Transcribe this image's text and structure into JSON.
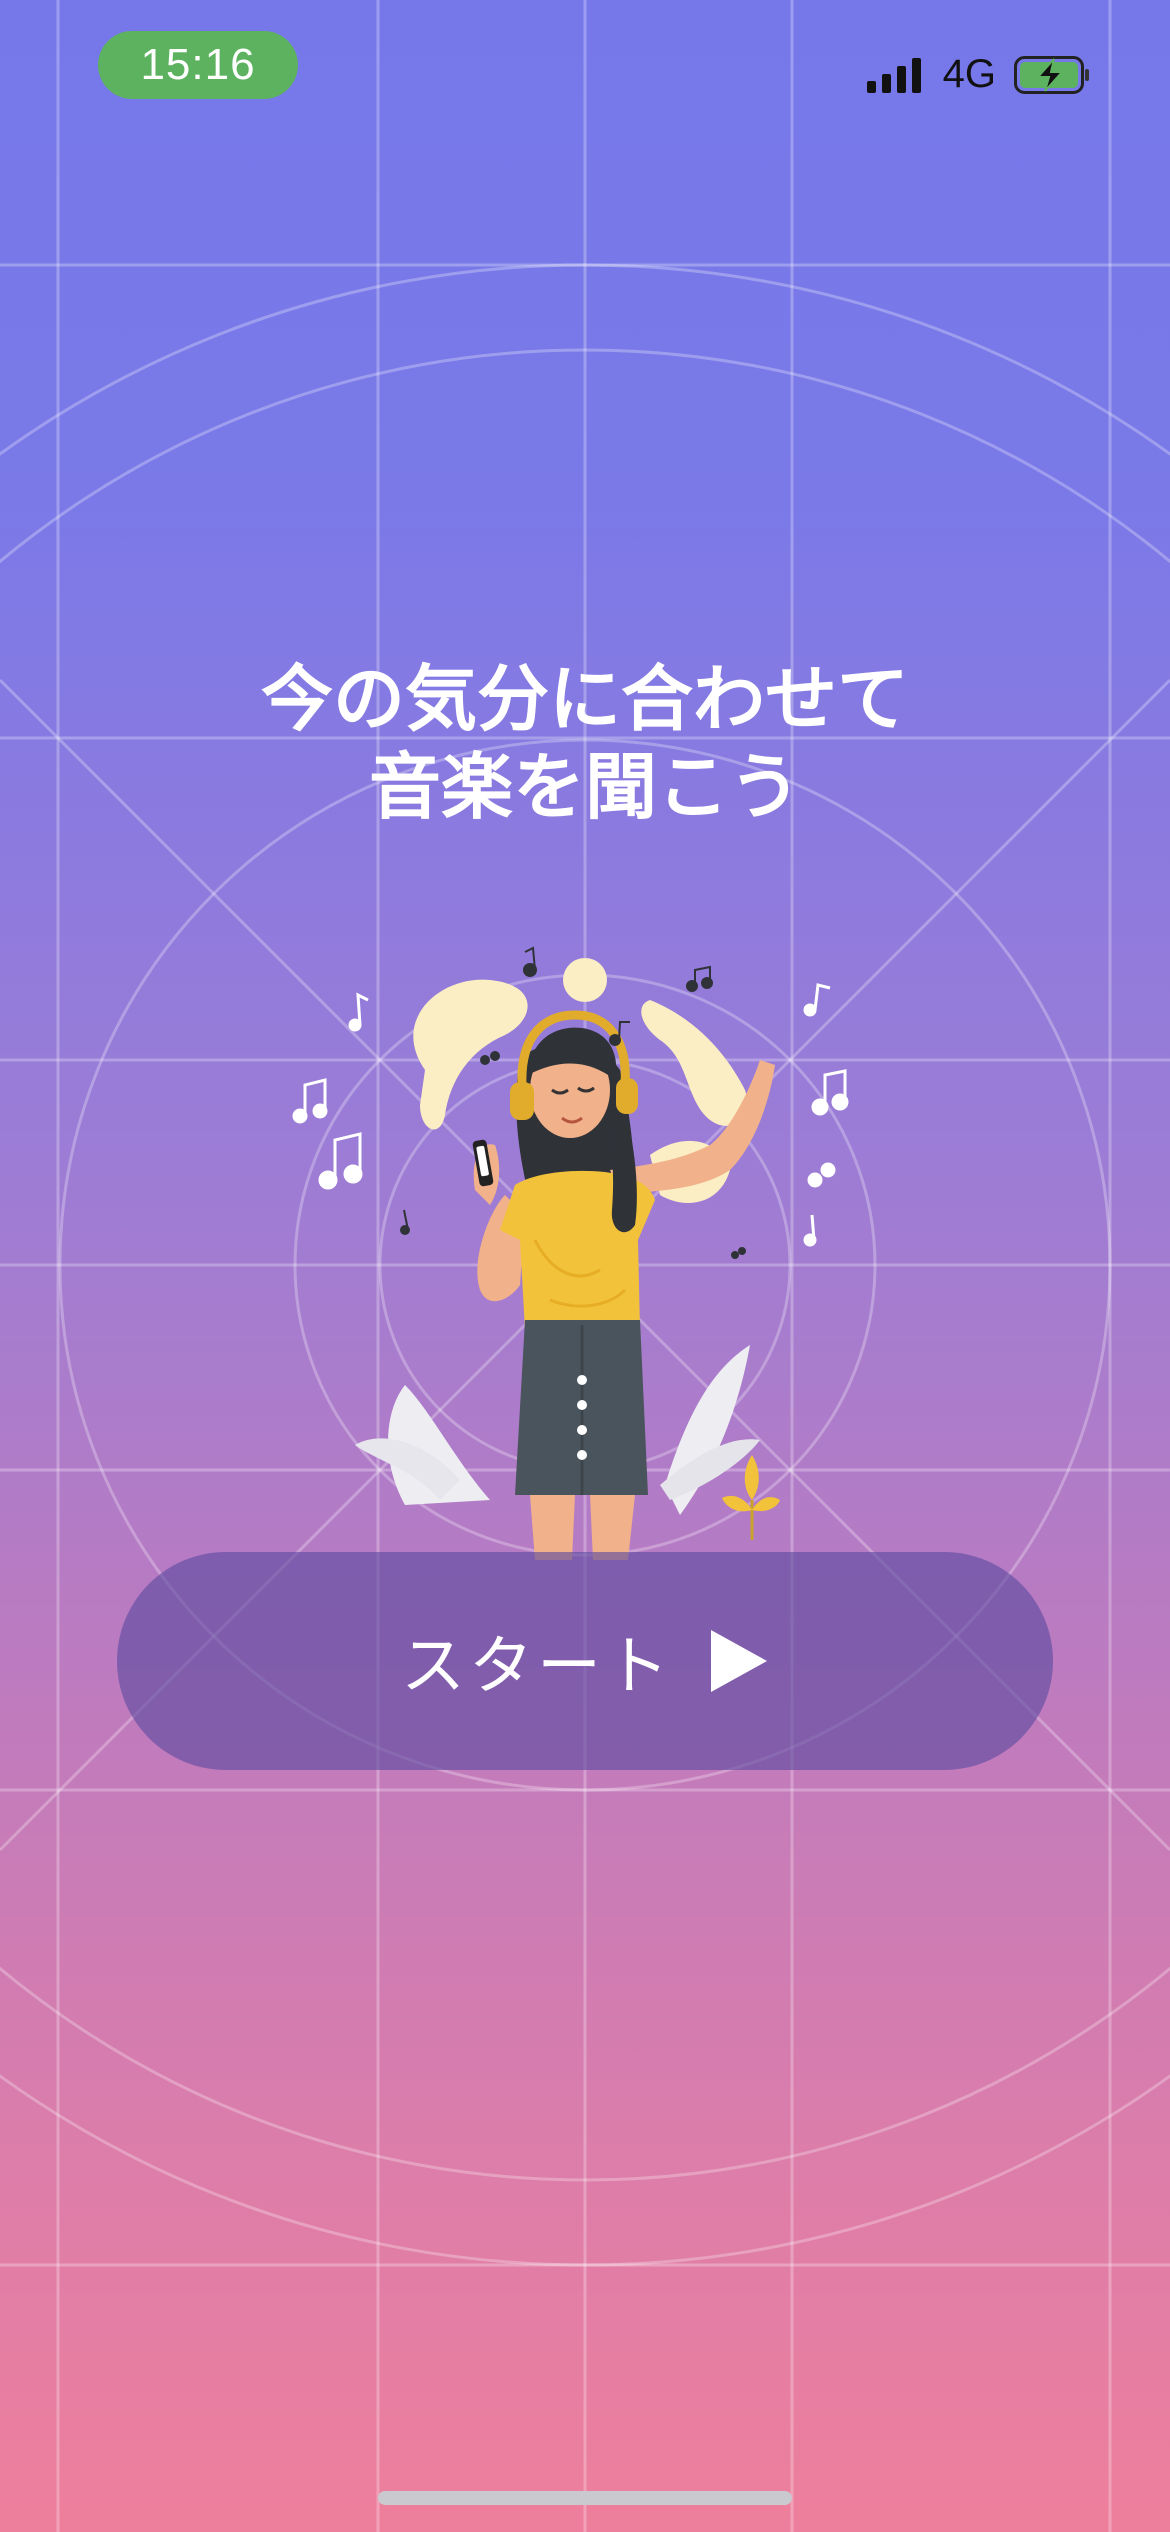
{
  "status_bar": {
    "time": "15:16",
    "network": "4G",
    "signal_bars": 4,
    "battery_state": "charging",
    "colors": {
      "time_pill": "#5db260",
      "battery_fill": "#5db260"
    }
  },
  "headline": {
    "line1": "今の気分に合わせて",
    "line2": "音楽を聞こう"
  },
  "illustration": {
    "subject": "woman-with-headphones-listening-to-music-icon"
  },
  "start_button": {
    "label": "スタート",
    "icon": "play-icon"
  },
  "theme": {
    "gradient_top": "#7678ea",
    "gradient_bottom": "#ee7f9c",
    "skirt": "#4a545c",
    "shirt": "#f2c23a"
  }
}
